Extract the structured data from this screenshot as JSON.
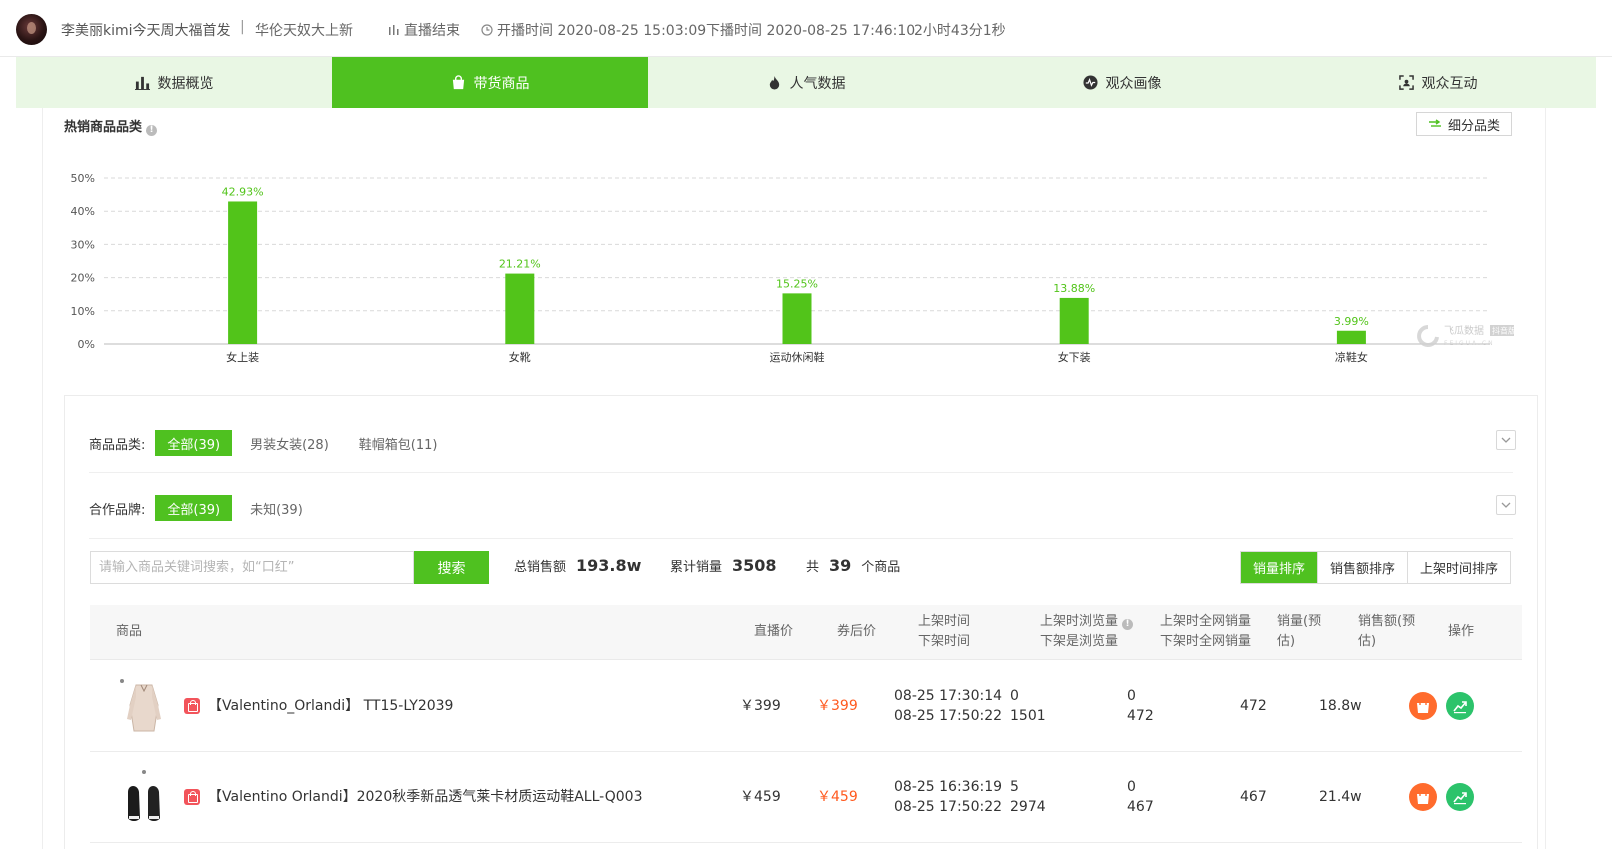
{
  "header": {
    "streamer_title": "李美丽kimi今天周大福首发",
    "separator": "|",
    "live_topic": "华伦天奴大上新",
    "status": "直播结束",
    "start_time": "开播时间 2020-08-25 15:03:09",
    "end_time": "下播时间 2020-08-25 17:46:10",
    "duration": "2小时43分1秒"
  },
  "tabs": [
    {
      "label": "数据概览",
      "icon": "bar-chart-icon",
      "active": false
    },
    {
      "label": "带货商品",
      "icon": "shopping-bag-icon",
      "active": true
    },
    {
      "label": "人气数据",
      "icon": "flame-icon",
      "active": false
    },
    {
      "label": "观众画像",
      "icon": "pulse-icon",
      "active": false
    },
    {
      "label": "观众互动",
      "icon": "scan-icon",
      "active": false
    }
  ],
  "section": {
    "title": "热销商品品类",
    "info": "!",
    "subcategory_button": "细分品类"
  },
  "chart_data": {
    "type": "bar",
    "categories": [
      "女上装",
      "女靴",
      "运动休闲鞋",
      "女下装",
      "凉鞋女"
    ],
    "values": [
      42.93,
      21.21,
      15.25,
      13.88,
      3.99
    ],
    "data_labels": [
      "42.93%",
      "21.21%",
      "15.25%",
      "13.88%",
      "3.99%"
    ],
    "y_ticks": [
      "0%",
      "10%",
      "20%",
      "30%",
      "40%",
      "50%"
    ],
    "ylim": [
      0,
      50
    ],
    "grid": true,
    "bar_color": "#52c41a"
  },
  "watermark": {
    "brand": "飞瓜数据",
    "badge": "抖音版",
    "sub": "FEIGUA.CN"
  },
  "filters": {
    "category": {
      "label": "商品品类:",
      "options": [
        {
          "label": "全部(39)",
          "active": true
        },
        {
          "label": "男装女装(28)",
          "active": false
        },
        {
          "label": "鞋帽箱包(11)",
          "active": false
        }
      ]
    },
    "brand": {
      "label": "合作品牌:",
      "options": [
        {
          "label": "全部(39)",
          "active": true
        },
        {
          "label": "未知(39)",
          "active": false
        }
      ]
    }
  },
  "search": {
    "placeholder": "请输入商品关键词搜索，如“口红”",
    "value": "",
    "button": "搜索"
  },
  "stats": {
    "total_sales_label": "总销售额",
    "total_sales_value": "193.8w",
    "total_volume_label": "累计销量",
    "total_volume_value": "3508",
    "count_prefix": "共",
    "count_value": "39",
    "count_suffix": "个商品"
  },
  "sort": [
    {
      "label": "销量排序",
      "active": true
    },
    {
      "label": "销售额排序",
      "active": false
    },
    {
      "label": "上架时间排序",
      "active": false
    }
  ],
  "table": {
    "headers": {
      "product": "商品",
      "live_price": "直播价",
      "coupon_price": "券后价",
      "time_on": "上架时间",
      "time_off": "下架时间",
      "views_on": "上架时浏览量",
      "views_off": "下架是浏览量",
      "net_on": "上架时全网销量",
      "net_off": "下架时全网销量",
      "volume_l1": "销量(预",
      "volume_l2": "估)",
      "amount_l1": "销售额(预",
      "amount_l2": "估)",
      "ops": "操作"
    },
    "rows": [
      {
        "name": "【Valentino_Orlandi】 TT15-LY2039",
        "live_price": "￥399",
        "coupon_price": "￥399",
        "time_on": "08-25 17:30:14",
        "time_off": "08-25 17:50:22",
        "views_on": "0",
        "views_off": "1501",
        "net_on": "0",
        "net_off": "472",
        "volume": "472",
        "amount": "18.8w"
      },
      {
        "name": "【Valentino Orlandi】2020秋季新品透气莱卡材质运动鞋ALL-Q003",
        "live_price": "￥459",
        "coupon_price": "￥459",
        "time_on": "08-25 16:36:19",
        "time_off": "08-25 17:50:22",
        "views_on": "5",
        "views_off": "2974",
        "net_on": "0",
        "net_off": "467",
        "volume": "467",
        "amount": "21.4w"
      }
    ]
  }
}
